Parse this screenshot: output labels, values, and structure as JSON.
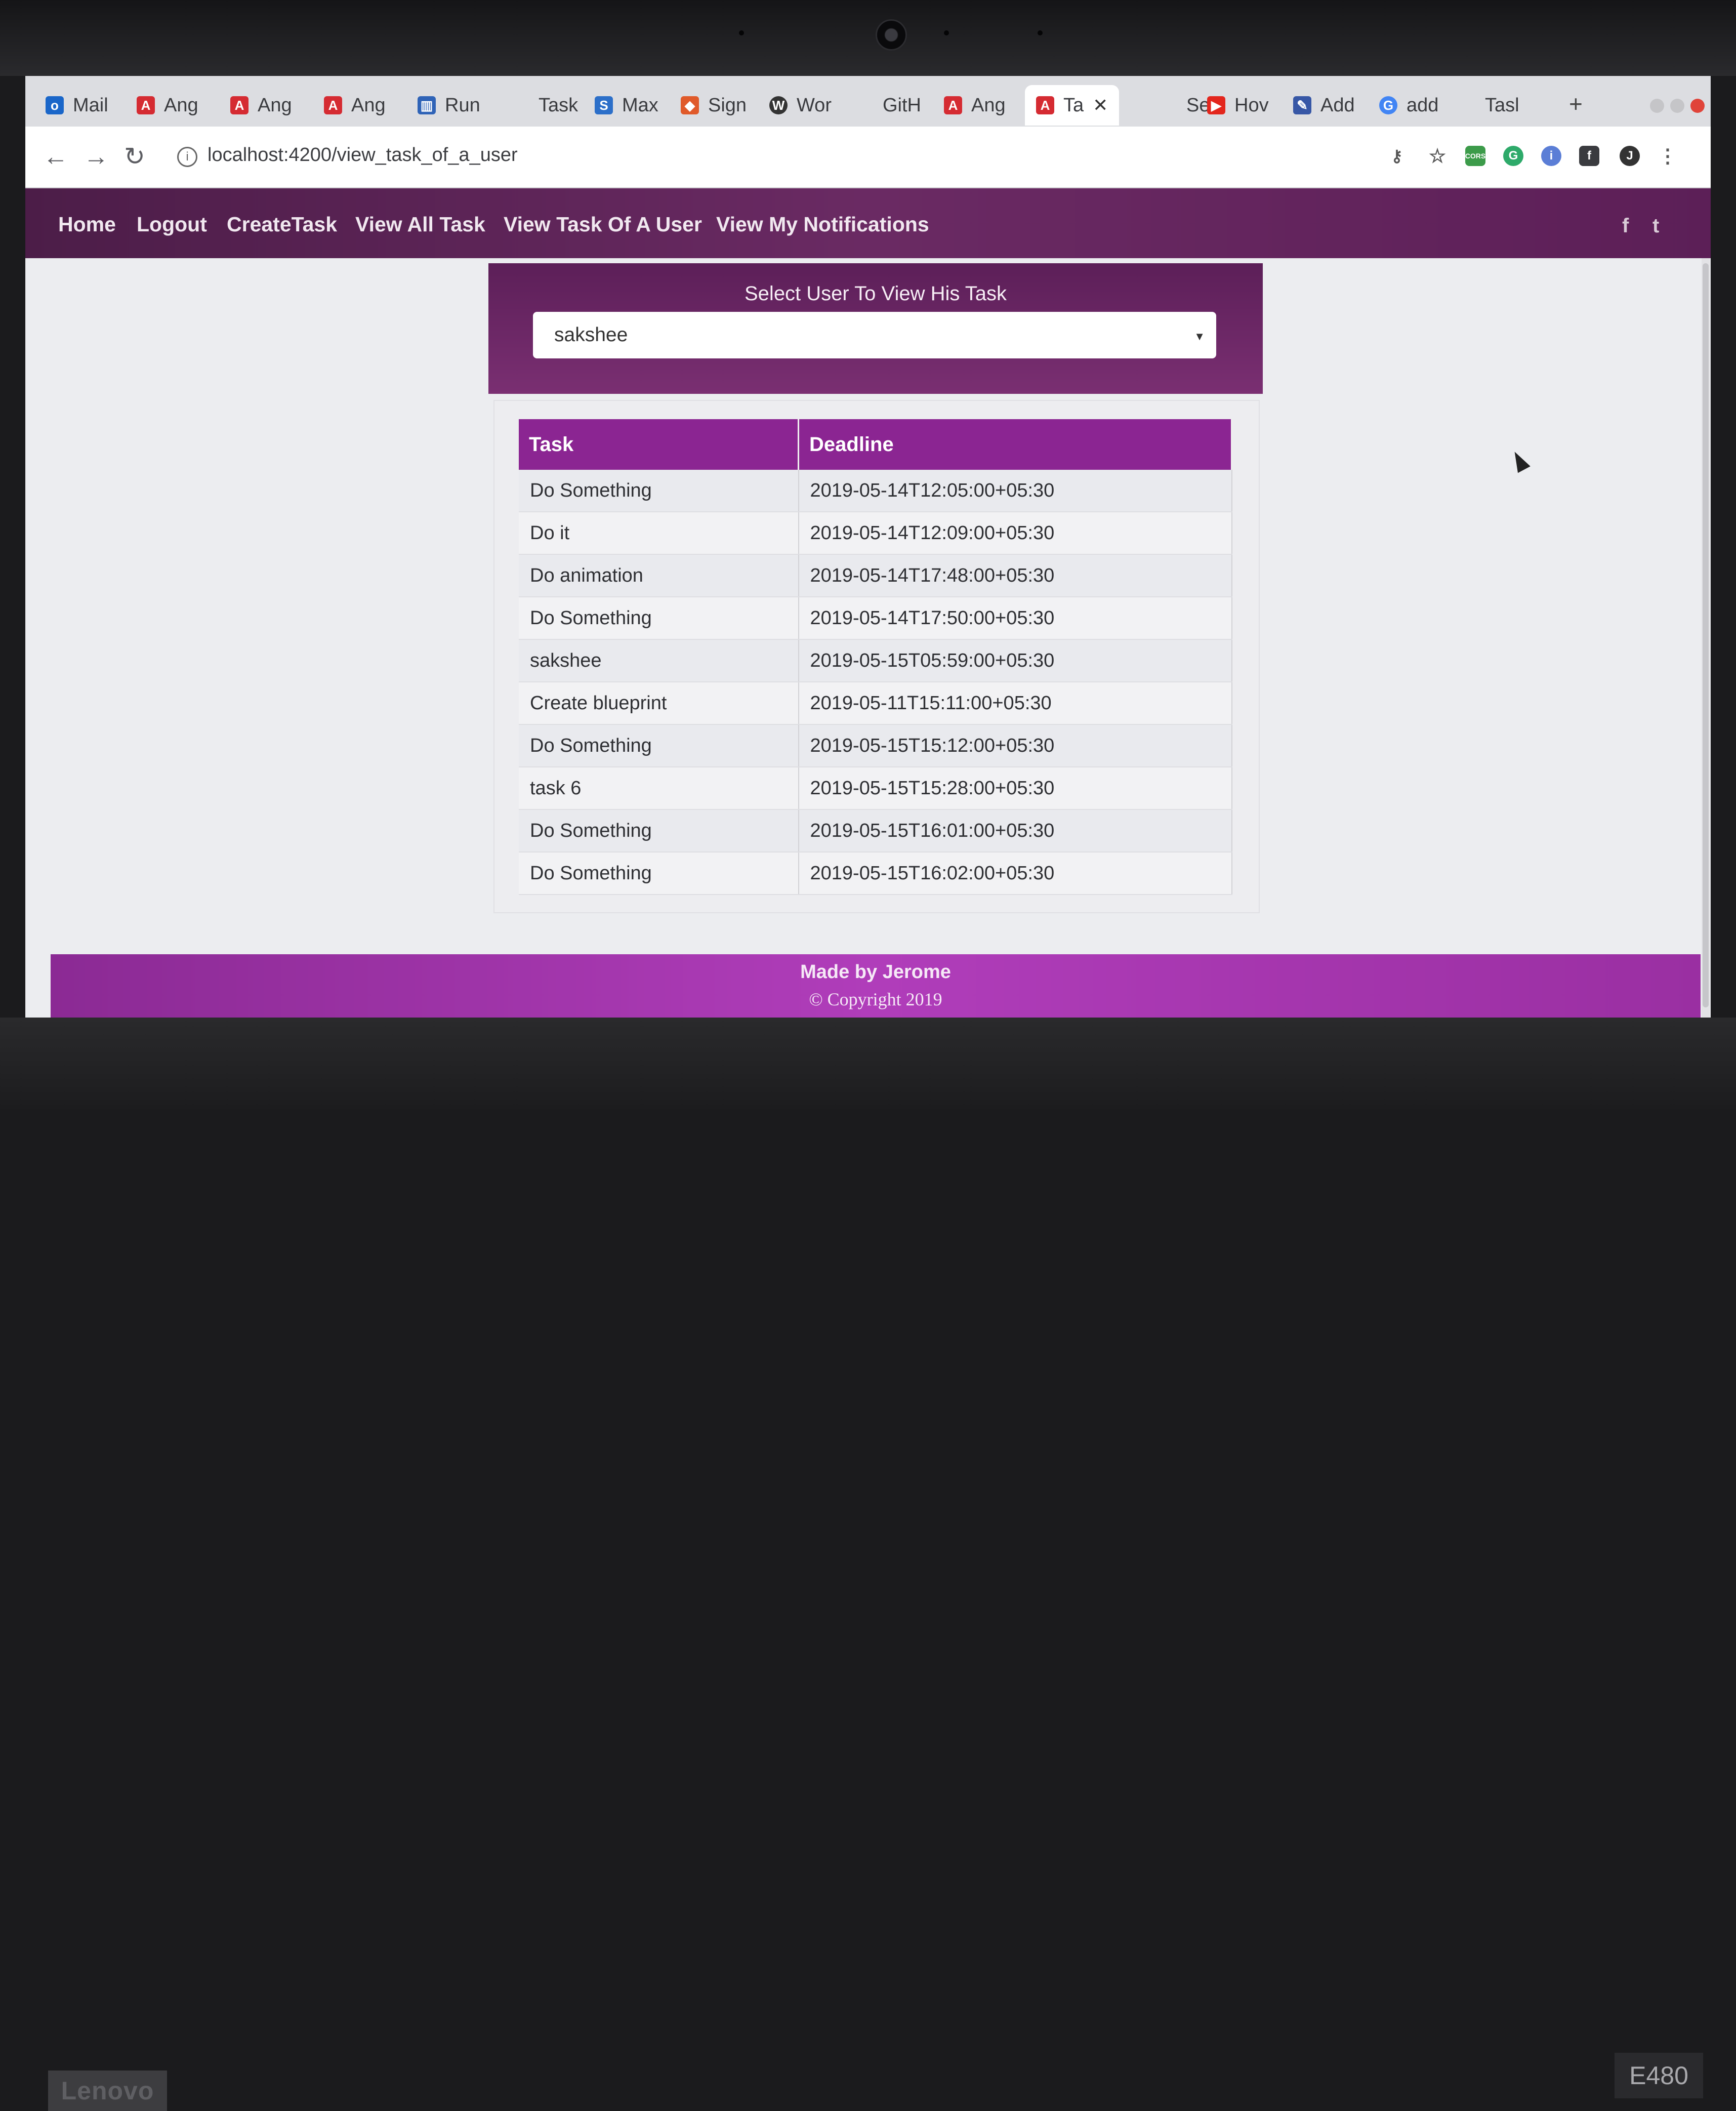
{
  "browser": {
    "tabs": [
      {
        "label": "Mail",
        "icon": "outlook-icon",
        "color": "#1a66c9"
      },
      {
        "label": "Ang",
        "icon": "angular-icon",
        "color": "#d52b32"
      },
      {
        "label": "Ang",
        "icon": "angular-icon",
        "color": "#d52b32"
      },
      {
        "label": "Ang",
        "icon": "angular-icon",
        "color": "#d52b32"
      },
      {
        "label": "Run",
        "icon": "stackblitz-icon",
        "color": "#2f63b7"
      },
      {
        "label": "Task",
        "icon": "page-icon",
        "color": "#999999"
      },
      {
        "label": "Max",
        "icon": "stack-icon",
        "color": "#2c6fc9"
      },
      {
        "label": "Sign",
        "icon": "gitlab-icon",
        "color": "#e05a2a"
      },
      {
        "label": "Wor",
        "icon": "wordpress-icon",
        "color": "#333333"
      },
      {
        "label": "GitH",
        "icon": "page-icon",
        "color": "#999999"
      },
      {
        "label": "Ang",
        "icon": "angular-icon",
        "color": "#d52b32"
      },
      {
        "label": "Ta",
        "icon": "angular-icon",
        "color": "#d52b32",
        "active": true
      },
      {
        "label": "Sele",
        "icon": "page-icon",
        "color": "#999999"
      },
      {
        "label": "Hov",
        "icon": "youtube-icon",
        "color": "#e3261d"
      },
      {
        "label": "Add",
        "icon": "page-icon",
        "color": "#3757a6"
      },
      {
        "label": "add",
        "icon": "google-icon",
        "color": "#4285f4"
      },
      {
        "label": "Tasl",
        "icon": "page-icon",
        "color": "#999999"
      }
    ],
    "active_tab_close": "✕",
    "new_tab": "+",
    "url": "localhost:4200/view_task_of_a_user"
  },
  "nav": {
    "links": [
      "Home",
      "Logout",
      "CreateTask",
      "View All Task",
      "View Task Of A User",
      "View My Notifications"
    ],
    "social": [
      "f",
      "t"
    ]
  },
  "panel": {
    "title": "Select User To View His Task",
    "selected_user": "sakshee"
  },
  "table": {
    "headers": [
      "Task",
      "Deadline"
    ],
    "rows": [
      [
        "Do Something",
        "2019-05-14T12:05:00+05:30"
      ],
      [
        "Do it",
        "2019-05-14T12:09:00+05:30"
      ],
      [
        "Do animation",
        "2019-05-14T17:48:00+05:30"
      ],
      [
        "Do Something",
        "2019-05-14T17:50:00+05:30"
      ],
      [
        "sakshee",
        "2019-05-15T05:59:00+05:30"
      ],
      [
        "Create blueprint",
        "2019-05-11T15:11:00+05:30"
      ],
      [
        "Do Something",
        "2019-05-15T15:12:00+05:30"
      ],
      [
        "task 6",
        "2019-05-15T15:28:00+05:30"
      ],
      [
        "Do Something",
        "2019-05-15T16:01:00+05:30"
      ],
      [
        "Do Something",
        "2019-05-15T16:02:00+05:30"
      ]
    ]
  },
  "footer": {
    "made_by": "Made by Jerome",
    "copyright": "© Copyright 2019"
  },
  "device": {
    "brand": "Lenovo",
    "model": "E480"
  }
}
